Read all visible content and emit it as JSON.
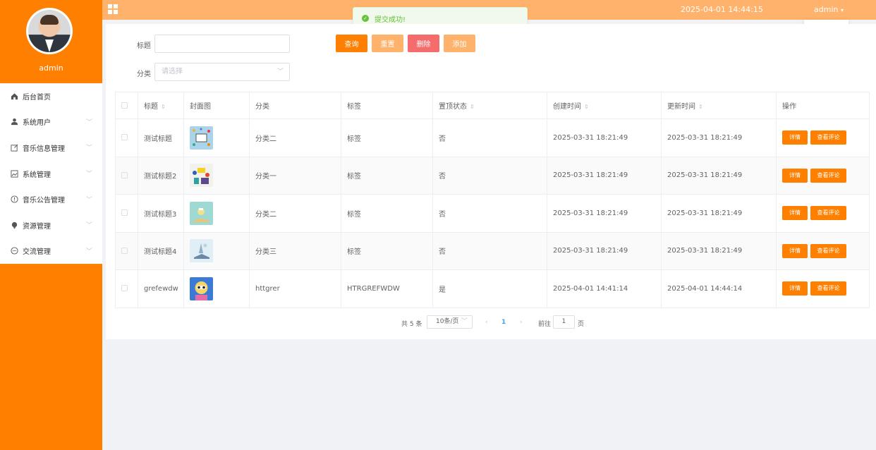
{
  "sidebar": {
    "username": "admin",
    "items": [
      {
        "label": "后台首页",
        "icon": "home-icon"
      },
      {
        "label": "系统用户",
        "icon": "user-icon"
      },
      {
        "label": "音乐信息管理",
        "icon": "edit-icon"
      },
      {
        "label": "系统管理",
        "icon": "picture-icon"
      },
      {
        "label": "音乐公告管理",
        "icon": "info-icon"
      },
      {
        "label": "资源管理",
        "icon": "location-icon"
      },
      {
        "label": "交流管理",
        "icon": "chat-icon"
      }
    ]
  },
  "header": {
    "datetime": "2025-04-01 14:44:15",
    "user_label": "admin",
    "user_caret": "▾"
  },
  "toast": {
    "message": "提交成功!"
  },
  "filters": {
    "title_label": "标题",
    "category_label": "分类",
    "category_placeholder": "请选择",
    "query_label": "查询",
    "reset_label": "重置",
    "delete_label": "删除",
    "add_label": "添加"
  },
  "table": {
    "columns": [
      "标题",
      "封面图",
      "分类",
      "标签",
      "置顶状态",
      "创建时间",
      "更新时间",
      "操作"
    ],
    "rows": [
      {
        "title": "测试标题",
        "category": "分类二",
        "tag": "标签",
        "pinned": "否",
        "created": "2025-03-31 18:21:49",
        "updated": "2025-03-31 18:21:49"
      },
      {
        "title": "测试标题2",
        "category": "分类一",
        "tag": "标签",
        "pinned": "否",
        "created": "2025-03-31 18:21:49",
        "updated": "2025-03-31 18:21:49"
      },
      {
        "title": "测试标题3",
        "category": "分类二",
        "tag": "标签",
        "pinned": "否",
        "created": "2025-03-31 18:21:49",
        "updated": "2025-03-31 18:21:49"
      },
      {
        "title": "测试标题4",
        "category": "分类三",
        "tag": "标签",
        "pinned": "否",
        "created": "2025-03-31 18:21:49",
        "updated": "2025-03-31 18:21:49"
      },
      {
        "title": "grefewdw",
        "category": "httgrer",
        "tag": "HTRGREFWDW",
        "pinned": "是",
        "created": "2025-04-01 14:41:14",
        "updated": "2025-04-01 14:44:14"
      }
    ],
    "detail_label": "详情",
    "comments_label": "查看评论"
  },
  "pagination": {
    "total_text": "共 5 条",
    "page_size": "10条/页",
    "current_page": "1",
    "goto_label": "前往",
    "goto_value": "1",
    "page_unit": "页"
  },
  "colors": {
    "brand": "#ff8000",
    "header": "#ffb26b",
    "reset": "#ffb26b",
    "delete": "#f56c6c",
    "success": "#67c23a"
  }
}
